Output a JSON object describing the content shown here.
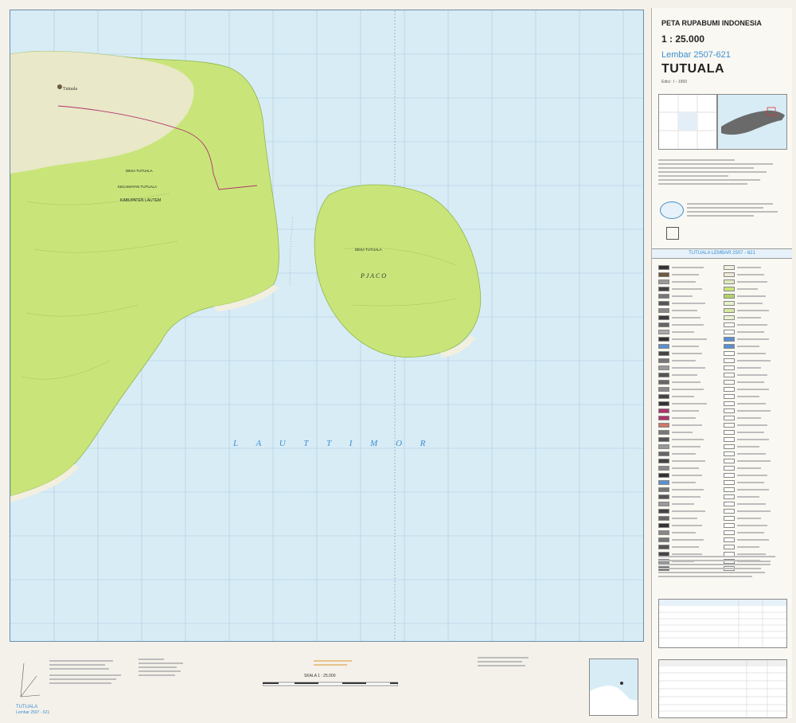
{
  "header": {
    "series": "PETA RUPABUMI INDONESIA",
    "scale": "1 : 25.000",
    "sheet_number": "Lembar 2507-621",
    "sheet_name": "TUTUALA",
    "edition": "Edisi : I - 1993",
    "band_title": "TUTUALA  LEMBAR 2507 - 621"
  },
  "map_labels": {
    "village": "Tutuala",
    "desa_left": "DESA TUTUALA",
    "kecamatan": "KECAMATAN TUTUALA",
    "kabupaten": "KABUPATEN LAUTEM",
    "desa_island": "DESA TUTUALA",
    "island": "P J A C O",
    "sea": "L A U T   T I M O R"
  },
  "footer": {
    "scale_text": "SKALA  1 : 25.000",
    "sheet_name": "TUTUALA",
    "sheet_number": "Lembar 2507 - 621"
  },
  "colors": {
    "sea": "#d8ecf6",
    "land": "#c9e57a",
    "land_dark": "#b3d466",
    "grid": "#a9cbe0",
    "accent_blue": "#3b8fd0"
  }
}
